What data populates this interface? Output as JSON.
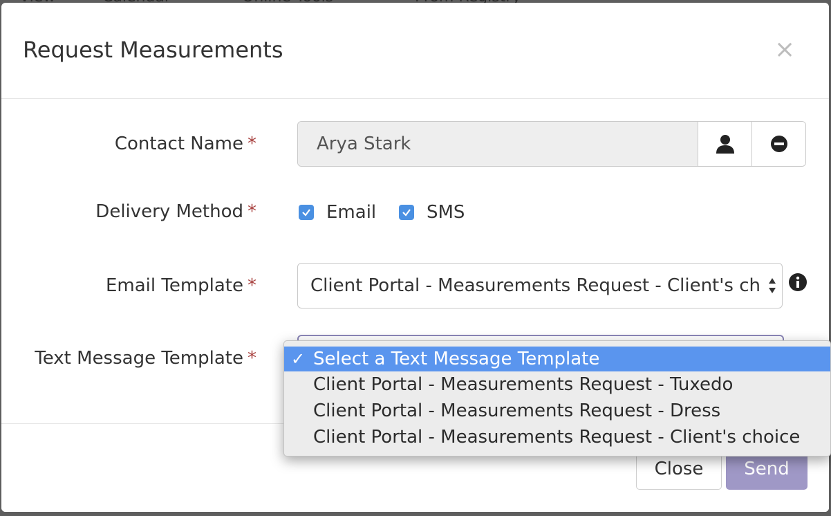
{
  "background_nav": {
    "items": [
      "View",
      "Calendar",
      "Online Tools",
      "Prom Registry"
    ]
  },
  "modal": {
    "title": "Request Measurements",
    "close_glyph": "×"
  },
  "form": {
    "required_marker": "*",
    "contact": {
      "label": "Contact Name",
      "value": "Arya Stark",
      "icons": [
        "user-icon",
        "minus-circle-icon"
      ]
    },
    "delivery": {
      "label": "Delivery Method",
      "options": [
        {
          "label": "Email",
          "checked": true
        },
        {
          "label": "SMS",
          "checked": true
        }
      ]
    },
    "email_template": {
      "label": "Email Template",
      "value": "Client Portal - Measurements Request - Client's choice"
    },
    "text_template": {
      "label": "Text Message Template",
      "options": [
        "Select a Text Message Template",
        "Client Portal - Measurements Request - Tuxedo",
        "Client Portal - Measurements Request - Dress",
        "Client Portal - Measurements Request - Client's choice"
      ],
      "selected_index": 0,
      "check_glyph": "✓"
    }
  },
  "footer": {
    "close_label": "Close",
    "send_label": "Send"
  },
  "colors": {
    "required": "#a94442",
    "checkbox": "#4a90e2",
    "send_button": "#9f98c6",
    "dropdown_highlight": "#5a95ee"
  }
}
